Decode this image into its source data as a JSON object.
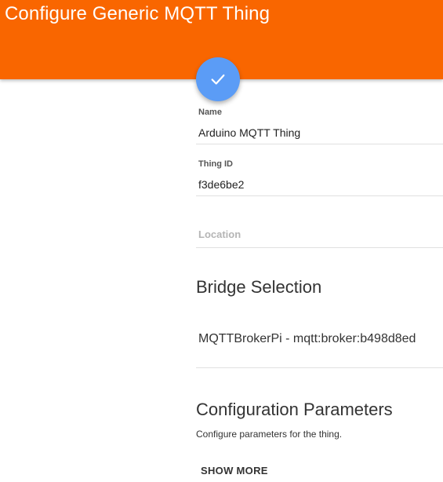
{
  "header": {
    "title": "Configure Generic MQTT Thing",
    "color": "#f96600"
  },
  "fab": {
    "icon": "check-icon",
    "color": "#5b9cf6"
  },
  "form": {
    "name": {
      "label": "Name",
      "value": "Arduino MQTT Thing"
    },
    "thing_id": {
      "label": "Thing ID",
      "value": "f3de6be2"
    },
    "location": {
      "placeholder": "Location",
      "value": ""
    }
  },
  "bridge": {
    "title": "Bridge Selection",
    "selected": "MQTTBrokerPi - mqtt:broker:b498d8ed"
  },
  "config": {
    "title": "Configuration Parameters",
    "description": "Configure parameters for the thing.",
    "show_more": "SHOW MORE"
  }
}
